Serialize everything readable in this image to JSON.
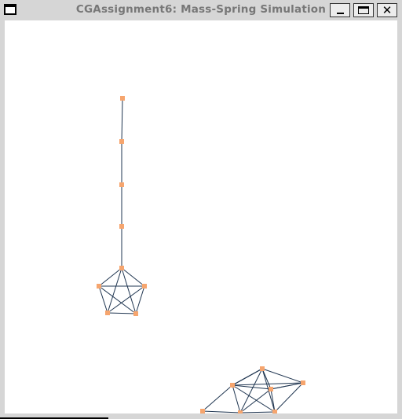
{
  "window": {
    "title": "CGAssignment6: Mass-Spring Simulation",
    "controls": [
      {
        "name": "minimize-button",
        "icon": "minimize-icon"
      },
      {
        "name": "maximize-button",
        "icon": "maximize-icon"
      },
      {
        "name": "close-button",
        "icon": "close-icon"
      }
    ],
    "menu_icon": "window-menu-icon"
  },
  "scene": {
    "colors": {
      "background": "#ffffff",
      "spring": "#1f3550",
      "mass": "#f6a56e"
    }
  }
}
